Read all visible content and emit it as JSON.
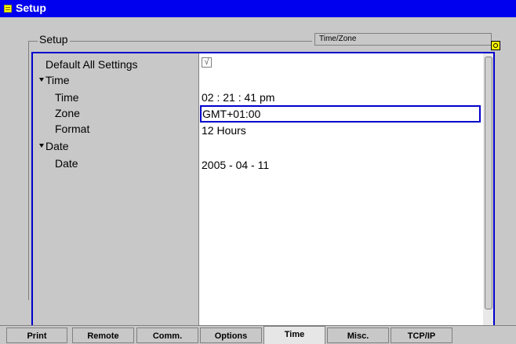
{
  "window": {
    "title": "Setup"
  },
  "group": {
    "label": "Setup",
    "subtab": "Time/Zone"
  },
  "settings": {
    "default_all": {
      "label": "Default All Settings",
      "checked": true,
      "check_glyph": "√"
    },
    "time_section": {
      "label": "Time"
    },
    "time": {
      "label": "Time",
      "value": "02 : 21 : 41 pm"
    },
    "zone": {
      "label": "Zone",
      "value": "GMT+01:00"
    },
    "format": {
      "label": "Format",
      "value": "12 Hours"
    },
    "date_section": {
      "label": "Date"
    },
    "date": {
      "label": "Date",
      "value": "2005 - 04 - 11"
    }
  },
  "tabs": [
    {
      "label": "Print",
      "active": false
    },
    {
      "label": "Remote",
      "active": false
    },
    {
      "label": "Comm.",
      "active": false
    },
    {
      "label": "Options",
      "active": false
    },
    {
      "label": "Time",
      "active": true
    },
    {
      "label": "Misc.",
      "active": false
    },
    {
      "label": "TCP/IP",
      "active": false
    }
  ],
  "colors": {
    "titlebar": "#0000ee",
    "focus_border": "#0000cc",
    "corner_icon": "#ffff00"
  }
}
